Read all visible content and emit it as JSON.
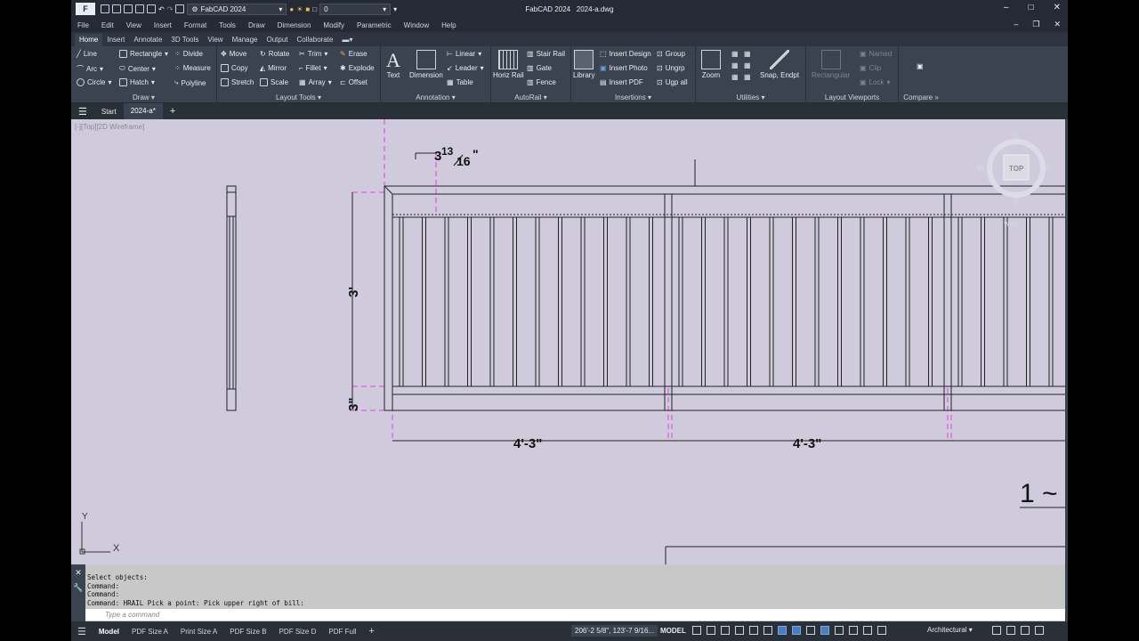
{
  "app": {
    "name": "FabCAD 2024",
    "file": "2024-a.dwg"
  },
  "qat": {
    "workspace": "FabCAD 2024",
    "layer": "0"
  },
  "menu": [
    "File",
    "Edit",
    "View",
    "Insert",
    "Format",
    "Tools",
    "Draw",
    "Dimension",
    "Modify",
    "Parametric",
    "Window",
    "Help"
  ],
  "ribbon_tabs": [
    "Home",
    "Insert",
    "Annotate",
    "3D Tools",
    "View",
    "Manage",
    "Output",
    "Collaborate"
  ],
  "panels": {
    "draw": {
      "title": "Draw",
      "items": [
        "Line",
        "Arc",
        "Circle",
        "Rectangle",
        "Center",
        "Hatch",
        "Divide",
        "Measure",
        "Polyline"
      ]
    },
    "layout_tools": {
      "title": "Layout Tools",
      "items": [
        "Move",
        "Copy",
        "Stretch",
        "Rotate",
        "Mirror",
        "Scale",
        "Trim",
        "Fillet",
        "Array",
        "Erase",
        "Explode",
        "Offset"
      ]
    },
    "annotation": {
      "title": "Annotation",
      "items": [
        "Text",
        "Dimension",
        "Linear",
        "Leader",
        "Table"
      ]
    },
    "autorail": {
      "title": "AutoRail",
      "items": [
        "Horiz Rail",
        "Stair Rail",
        "Gate",
        "Fence"
      ]
    },
    "insertions": {
      "title": "Insertions",
      "items": [
        "Library",
        "Insert Design",
        "Insert Photo",
        "Insert PDF",
        "Group",
        "Ungrp",
        "Ugp all"
      ]
    },
    "utilities": {
      "title": "Utilities",
      "items": [
        "Zoom",
        "Snap, Endpt"
      ]
    },
    "layout_viewports": {
      "title": "Layout Viewports",
      "items": [
        "Rectangular",
        "Named",
        "Clip",
        "Lock"
      ]
    },
    "compare": {
      "title": "Compare"
    }
  },
  "doc_tabs": [
    "Start",
    "2024-a*"
  ],
  "viewport": {
    "label": "[-][Top][2D Wireframe]",
    "viewcube": {
      "face": "TOP",
      "n": "N",
      "s": "S",
      "e": "E",
      "w": "W",
      "wcs": "WCS"
    }
  },
  "drawing": {
    "dims": {
      "top": "3",
      "top_frac_num": "13",
      "top_frac_den": "16",
      "height": "3'",
      "bottom": "3\"",
      "span1": "4'-3\"",
      "span2": "4'-3\"",
      "callout": "1 ~"
    },
    "ucs": {
      "x": "X",
      "y": "Y"
    }
  },
  "command": {
    "lines": [
      "Select objects:",
      "Command:",
      "Command:",
      "Command: HRAIL Pick a point: Pick upper right of bill:"
    ],
    "placeholder": "Type a command"
  },
  "status": {
    "layouts": [
      "Model",
      "PDF Size A",
      "Print Size A",
      "PDF Size B",
      "PDF Size D",
      "PDF Full"
    ],
    "coords": "206'-2 5/8\", 123'-7 9/16...",
    "mode": "MODEL",
    "units": "Architectural"
  }
}
